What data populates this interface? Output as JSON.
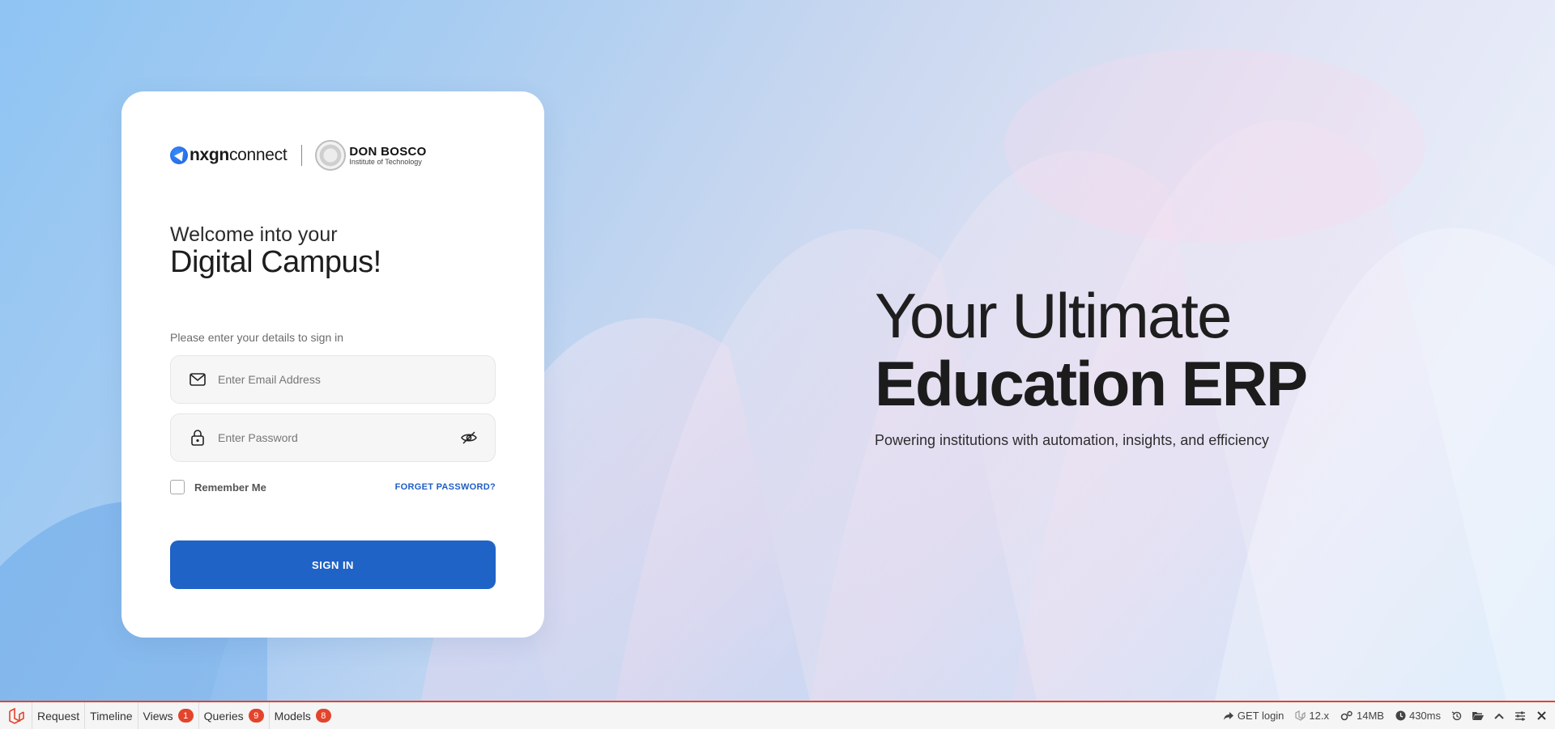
{
  "brand": {
    "nx_bold": "nxgn",
    "nx_light": "connect",
    "partner_name": "DON BOSCO",
    "partner_subtitle": "Institute of Technology"
  },
  "login": {
    "welcome": "Welcome into your",
    "campus": "Digital Campus!",
    "hint": "Please enter your details to sign in",
    "email_placeholder": "Enter Email Address",
    "password_placeholder": "Enter Password",
    "remember_label": "Remember Me",
    "forgot_label": "FORGET PASSWORD?",
    "signin_label": "SIGN IN"
  },
  "hero": {
    "line1": "Your Ultimate",
    "line2": "Education ERP",
    "subtitle": "Powering institutions with automation, insights, and efficiency"
  },
  "debugbar": {
    "tabs": [
      {
        "label": "Request"
      },
      {
        "label": "Timeline"
      },
      {
        "label": "Views",
        "count": "1"
      },
      {
        "label": "Queries",
        "count": "9"
      },
      {
        "label": "Models",
        "count": "8"
      }
    ],
    "route": "GET login",
    "version": "12.x",
    "memory": "14MB",
    "duration": "430ms"
  },
  "colors": {
    "primary": "#1f63c7",
    "accent_red": "#e3442c"
  }
}
